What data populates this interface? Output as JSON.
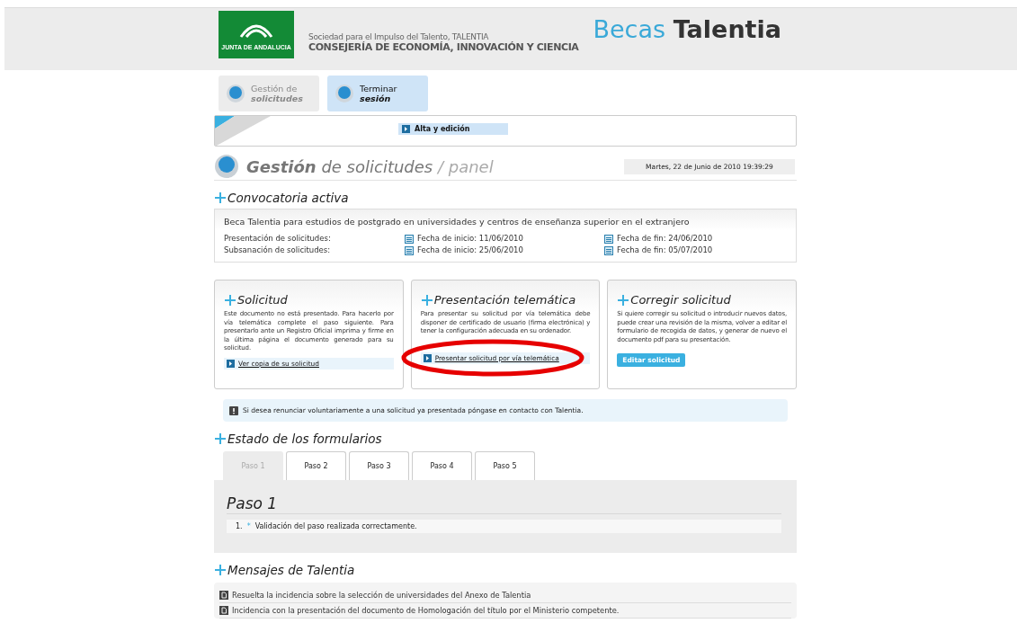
{
  "header": {
    "logo_text": "JUNTA DE ANDALUCIA",
    "org_line": "Sociedad para el Impulso del Talento, TALENTIA",
    "ministry": "CONSEJERÍA DE ECONOMÍA, INNOVACIÓN Y CIENCIA",
    "brand_first": "Becas",
    "brand_second": "Talentia"
  },
  "nav": [
    {
      "line1": "Gestión de",
      "line2": "solicitudes",
      "selected": false
    },
    {
      "line1": "Terminar",
      "line2": "sesión",
      "selected": true
    }
  ],
  "subnav": [
    {
      "label": "Alta y edición"
    }
  ],
  "page_title": {
    "main": "Gestión",
    "rest": "de solicitudes",
    "sub": "/ panel",
    "datetime": "Martes, 22 de Junio de 2010 19:39:29"
  },
  "convocatoria": {
    "heading": "Convocatoria activa",
    "title": "Beca Talentia para estudios de postgrado en universidades y centros de enseñanza superior en el extranjero",
    "rows": [
      {
        "label": "Presentación de solicitudes:",
        "start": "Fecha de inicio: 11/06/2010",
        "end": "Fecha de fin: 24/06/2010"
      },
      {
        "label": "Subsanación de solicitudes:",
        "start": "Fecha de inicio: 25/06/2010",
        "end": "Fecha de fin: 05/07/2010"
      }
    ]
  },
  "cards": [
    {
      "title": "Solicitud",
      "text": "Este documento no está presentado. Para hacerlo por vía telemática complete el paso siguiente. Para presentarlo ante un Registro Oficial imprima y firme en la última página el documento generado para su solicitud.",
      "action": {
        "kind": "link",
        "label": "Ver copia de su solicitud"
      }
    },
    {
      "title": "Presentación telemática",
      "text": "Para presentar su solicitud por vía telemática debe disponer de certificado de usuario (firma electrónica) y tener la configuración adecuada en su ordenador.",
      "action": {
        "kind": "link",
        "label": "Presentar solicitud por vía telemática"
      },
      "circled": true
    },
    {
      "title": "Corregir solicitud",
      "text": "Si quiere corregir su solicitud o introducir nuevos datos, puede crear una revisión de la misma, volver a editar el formulario de recogida de datos, y generar de nuevo el documento pdf para su presentación.",
      "action": {
        "kind": "button",
        "label": "Editar solicitud"
      }
    }
  ],
  "notice": "Si desea renunciar voluntariamente a una solicitud ya presentada póngase en contacto con Talentia.",
  "estado": {
    "heading": "Estado de los formularios",
    "tabs": [
      {
        "label": "Paso 1",
        "selected": true
      },
      {
        "label": "Paso 2",
        "selected": false
      },
      {
        "label": "Paso 3",
        "selected": false
      },
      {
        "label": "Paso 4",
        "selected": false
      },
      {
        "label": "Paso 5",
        "selected": false
      }
    ],
    "panel_title": "Paso 1",
    "items": [
      {
        "number": "1.",
        "marker": "*",
        "text": "Validación del paso realizada correctamente."
      }
    ]
  },
  "mensajes": {
    "heading": "Mensajes de Talentia",
    "items": [
      "Resuelta la incidencia sobre la selección de universidades del Anexo de Talentia",
      "Incidencia con la presentación del documento de Homologación del título por el Ministerio competente."
    ]
  }
}
